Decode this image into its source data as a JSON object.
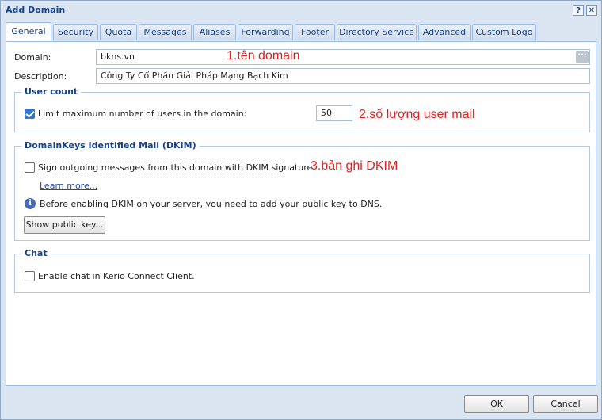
{
  "window": {
    "title": "Add Domain",
    "help_label": "?",
    "close_label": "✕"
  },
  "tabs": [
    {
      "label": "General"
    },
    {
      "label": "Security"
    },
    {
      "label": "Quota"
    },
    {
      "label": "Messages"
    },
    {
      "label": "Aliases"
    },
    {
      "label": "Forwarding"
    },
    {
      "label": "Footer"
    },
    {
      "label": "Directory Service"
    },
    {
      "label": "Advanced"
    },
    {
      "label": "Custom Logo"
    }
  ],
  "general": {
    "domain_label": "Domain:",
    "domain_value": "bkns.vn",
    "domain_trigger": "···",
    "description_label": "Description:",
    "description_value": "Công Ty Cổ Phần Giải Pháp Mạng Bạch Kim"
  },
  "user_count": {
    "legend": "User count",
    "limit_label": "Limit maximum number of users in the domain:",
    "limit_checked": true,
    "limit_value": "50"
  },
  "dkim": {
    "legend": "DomainKeys Identified Mail (DKIM)",
    "sign_label": "Sign outgoing messages from this domain with DKIM signature.",
    "sign_checked": false,
    "learn_more": "Learn more...",
    "info_text": "Before enabling DKIM on your server, you need to add your public key to DNS.",
    "info_icon": "i",
    "show_key_button": "Show public key..."
  },
  "chat": {
    "legend": "Chat",
    "enable_label": "Enable chat in Kerio Connect Client.",
    "enable_checked": false
  },
  "annotations": {
    "note1": "1.tên domain",
    "note2": "2.số lượng user mail",
    "note3": "3.bản ghi DKIM"
  },
  "footer": {
    "ok_label": "OK",
    "cancel_label": "Cancel"
  }
}
